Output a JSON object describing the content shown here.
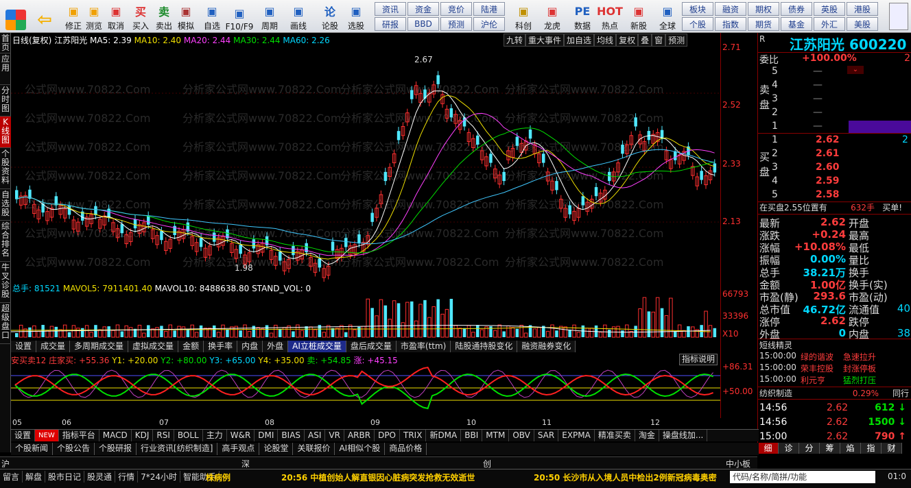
{
  "toolbar": {
    "buttons": [
      {
        "label": "修正",
        "icon": "up-down-arrow-icon"
      },
      {
        "label": "测览",
        "icon": "clock-icon"
      },
      {
        "label": "取消",
        "icon": "cancel-icon"
      },
      {
        "label": "买入",
        "icon": "buy-icon",
        "glyph": "买"
      },
      {
        "label": "卖出",
        "icon": "sell-icon",
        "glyph": "卖"
      },
      {
        "label": "模拟",
        "icon": "hammer-icon"
      },
      {
        "label": "自选",
        "icon": "star-icon"
      },
      {
        "label": "F10/F9",
        "icon": "f10-icon"
      },
      {
        "label": "周期",
        "icon": "period-icon"
      },
      {
        "label": "画线",
        "icon": "pencil-icon"
      },
      {
        "label": "论股",
        "icon": "chat-icon",
        "glyph": "论"
      },
      {
        "label": "选股",
        "icon": "stock-pick-icon"
      },
      {
        "label": "科创",
        "icon": "chart-icon"
      },
      {
        "label": "龙虎",
        "icon": "dragon-icon"
      },
      {
        "label": "数据",
        "icon": "pe-icon",
        "glyph": "PE"
      },
      {
        "label": "热点",
        "icon": "hot-icon",
        "glyph": "HOT"
      },
      {
        "label": "新股",
        "icon": "new-stock-icon"
      },
      {
        "label": "全球",
        "icon": "globe-icon"
      }
    ],
    "grid1": [
      "资讯",
      "资金",
      "竞价",
      "陆港",
      "研报",
      "BBD",
      "预测",
      "沪伦"
    ],
    "grid2": [
      "板块",
      "融资",
      "期权",
      "债券",
      "英股",
      "港股",
      "个股",
      "指数",
      "期货",
      "基金",
      "外汇",
      "美股"
    ]
  },
  "left_tabs": [
    "首页",
    "应用",
    "分时图",
    "K线图",
    "个股资料",
    "自选股",
    "综合排名",
    "牛叉诊股",
    "超级盘口"
  ],
  "chart": {
    "header": {
      "mode": "日线(复权)",
      "name": "江苏阳光",
      "ma5": "MA5: 2.39",
      "ma10": "MA10: 2.40",
      "ma20": "MA20: 2.44",
      "ma30": "MA30: 2.44",
      "ma60": "MA60: 2.26"
    },
    "header_buttons": [
      "九转",
      "重大事件",
      "加自选",
      "均线",
      "复权",
      "叠",
      "窗",
      "预测"
    ],
    "price_axis": [
      "2.71",
      "2.52",
      "2.33",
      "2.13"
    ],
    "max_label": "2.67",
    "min_label": "1.98",
    "watermark": "公式网www.70822.Com",
    "watermark2": "分析家公式网www.70822.Com",
    "volume_header": {
      "total": "总手: 81521",
      "mavol5": "MAVOL5: 7911401.40",
      "mavol10": "MAVOL10: 8488638.80",
      "stand": "STAND_VOL: 0"
    },
    "volume_axis": [
      "66793",
      "33396",
      "X10"
    ],
    "vol_tabs": [
      "设置",
      "成交量",
      "多周期成交量",
      "虚拟成交量",
      "金额",
      "换手率",
      "内盘",
      "外盘",
      "AI立桩成交量",
      "盘后成交量",
      "市盈率(ttm)",
      "陆股通持股变化",
      "融资融券变化"
    ],
    "ind_header": {
      "a": "安买卖12 庄家买: +55.36",
      "y1": "Y1: +20.00",
      "y2": "Y2: +80.00",
      "y3": "Y3: +65.00",
      "y4": "Y4: +35.00",
      "sell": "卖: +54.85",
      "up": "涨: +45.15"
    },
    "ind_button": "指标说明",
    "ind_axis": [
      "+86.31",
      "+50.00"
    ],
    "months": [
      "05",
      "06",
      "07",
      "08",
      "09",
      "10",
      "11",
      "12"
    ]
  },
  "chart_data": {
    "type": "line",
    "title": "江苏阳光",
    "y_price_ticks": [
      2.71,
      2.52,
      2.33,
      2.13
    ],
    "ma_values": {
      "MA5": 2.39,
      "MA10": 2.4,
      "MA20": 2.44,
      "MA30": 2.44,
      "MA60": 2.26
    },
    "high": 2.67,
    "low": 1.98,
    "volume_ticks": [
      66793,
      33396
    ]
  },
  "right": {
    "title": "江苏阳光",
    "code": "600220",
    "weibi_label": "委比",
    "weibi_value": "+100.00%",
    "weibi_extra": "2",
    "sell_label": "卖盘",
    "buy_label": "买盘",
    "sell_levels": [
      "5",
      "4",
      "3",
      "2",
      "1"
    ],
    "buy_levels": [
      {
        "n": "1",
        "p": "2.62",
        "v": "2"
      },
      {
        "n": "2",
        "p": "2.61"
      },
      {
        "n": "3",
        "p": "2.60"
      },
      {
        "n": "4",
        "p": "2.59"
      },
      {
        "n": "5",
        "p": "2.58"
      }
    ],
    "position_text": "在买盘2.55位置有",
    "position_vol": "632手",
    "position_buy": "买单!",
    "stats": [
      {
        "l": "最新",
        "v": "2.62",
        "l2": "开盘"
      },
      {
        "l": "涨跌",
        "v": "+0.24",
        "l2": "最高"
      },
      {
        "l": "涨幅",
        "v": "+10.08%",
        "l2": "最低"
      },
      {
        "l": "振幅",
        "v": "0.00%",
        "l2": "量比"
      },
      {
        "l": "总手",
        "v": "38.21万",
        "l2": "换手"
      },
      {
        "l": "金额",
        "v": "1.00亿",
        "l2": "换手(实)"
      },
      {
        "l": "市盈(静)",
        "v": "293.6",
        "l2": "市盈(动)"
      },
      {
        "l": "总市值",
        "v": "46.72亿",
        "l2": "流通值",
        "v2": "40"
      },
      {
        "l": "涨停",
        "v": "2.62",
        "l2": "跌停"
      },
      {
        "l": "外盘",
        "v": "0",
        "l2": "内盘",
        "v2": "38"
      }
    ],
    "short_title": "短线精灵",
    "short_items": [
      {
        "t": "15:00:00",
        "n": "绿的谐波",
        "s": "急速拉升"
      },
      {
        "t": "15:00:00",
        "n": "荣丰控股",
        "s": "封涨停板"
      },
      {
        "t": "15:00:00",
        "n": "利元亨",
        "s": "猛烈打压"
      }
    ],
    "sector": "纺织制造",
    "sector_pct": "0.29%",
    "sector_btn": "同行",
    "ticks": [
      {
        "t": "14:56",
        "p": "2.62",
        "v": "612"
      },
      {
        "t": "14:56",
        "p": "2.62",
        "v": "1500"
      },
      {
        "t": "15:00",
        "p": "2.62",
        "v": "790"
      }
    ],
    "bottom_tabs": [
      "细",
      "诊",
      "分",
      "筹",
      "焰",
      "指",
      "财"
    ]
  },
  "ind_tabs": [
    "设置",
    "NEW",
    "指标平台",
    "MACD",
    "KDJ",
    "RSI",
    "BOLL",
    "主力",
    "W&R",
    "DMI",
    "BIAS",
    "ASI",
    "VR",
    "ARBR",
    "DPO",
    "TRIX",
    "新DMA",
    "BBI",
    "MTM",
    "OBV",
    "SAR",
    "EXPMA",
    "精准买卖",
    "淘金",
    "操盘线加..."
  ],
  "news_tabs": [
    "个股新闻",
    "个股公告",
    "个股研报",
    "行业资讯[纺织制造]",
    "高手观点",
    "论股堂",
    "关联报价",
    "AI相似个股",
    "商品价格"
  ],
  "market": {
    "sh": "沪",
    "sz": "深",
    "cy": "创",
    "zx": "中小板指"
  },
  "status": {
    "items": [
      "留言",
      "解盘",
      "股市日记",
      "股灵通",
      "行情",
      "7*24小时",
      "智能助手"
    ],
    "news1": "株病例",
    "news2": "20:56 中植创始人解直银因心脏病突发抢救无效逝世",
    "news3": "20:50 长沙市从入境人员中检出2例新冠病毒奥密",
    "search": "代码/名称/简拼/功能",
    "time": "01:0"
  }
}
